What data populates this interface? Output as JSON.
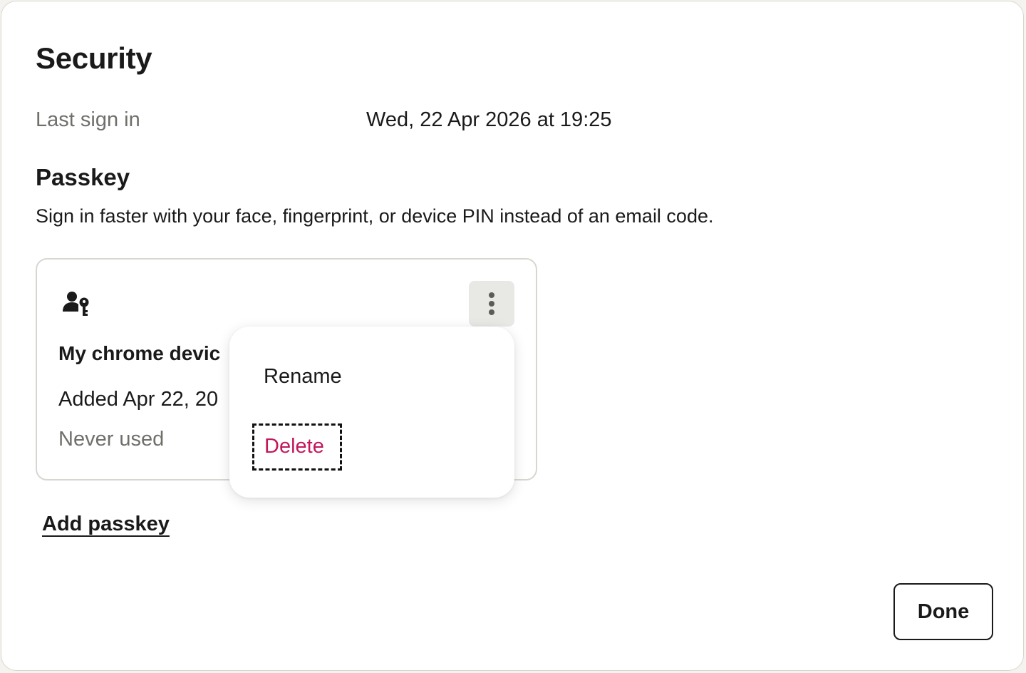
{
  "dialog": {
    "title": "Security",
    "last_sign_in": {
      "label": "Last sign in",
      "value": "Wed, 22 Apr 2026 at 19:25"
    },
    "passkey": {
      "heading": "Passkey",
      "description": "Sign in faster with your face, fingerprint, or device PIN instead of an email code."
    },
    "card": {
      "icon": "user-key-icon",
      "device_name": "My chrome devic",
      "added": "Added Apr 22, 20",
      "usage": "Never used",
      "menu_icon": "more-vertical-icon"
    },
    "menu": {
      "items": [
        {
          "label": "Rename"
        },
        {
          "label": "Delete",
          "color": "#c2185b",
          "focused": true
        }
      ]
    },
    "add_passkey_label": "Add passkey",
    "done_label": "Done"
  }
}
